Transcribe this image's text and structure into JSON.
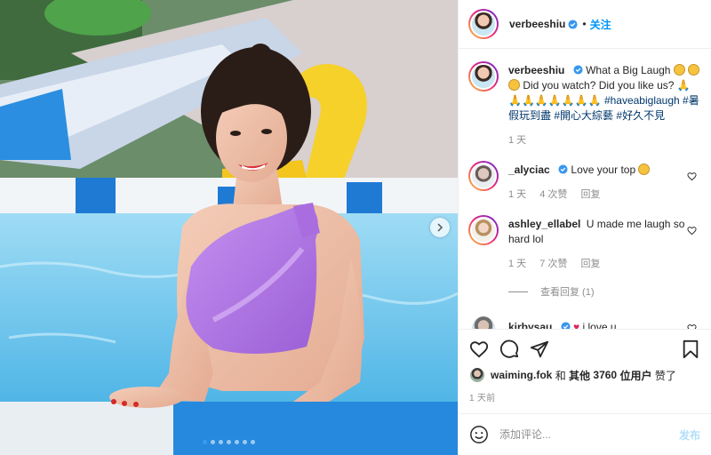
{
  "post": {
    "username": "verbeeshiu",
    "follow_separator": "•",
    "follow_label": "关注"
  },
  "caption": {
    "username": "verbeeshiu",
    "text_1": "What a Big Laugh",
    "text_2": "Did you watch? Did you like us?",
    "text_3": "🙏🙏🙏🙏🙏🙏🙏🙏",
    "tags": [
      "#haveabiglaugh",
      "#暑假玩到盡",
      "#開心大綜藝",
      "#好久不見"
    ],
    "time": "1 天"
  },
  "comments": [
    {
      "username": "_alyciac",
      "text": "Love your top",
      "time": "1 天",
      "likes": "4 次赞",
      "reply": "回复"
    },
    {
      "username": "ashley_ellabel",
      "text": "U made me laugh so hard lol",
      "time": "1 天",
      "likes": "7 次赞",
      "reply": "回复",
      "view_replies": "查看回复 (1)"
    },
    {
      "username": "kirbysau",
      "text": "i love u"
    }
  ],
  "likes": {
    "user": "waiming.fok",
    "and": "和",
    "others": "其他",
    "count": "3760",
    "suffix": "位用户",
    "liked": "赞了"
  },
  "timestamp": "1 天前",
  "add_comment": {
    "placeholder": "添加评论...",
    "post_label": "发布"
  },
  "carousel": {
    "count": 7,
    "active_index": 0
  },
  "colors": {
    "accent": "#0095f6",
    "verified": "#3897f0",
    "heart": "#e0245e",
    "muted": "#8e8e8e"
  }
}
